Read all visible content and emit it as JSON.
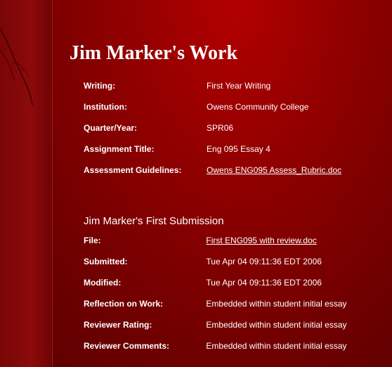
{
  "page": {
    "title": "Jim Marker's Work"
  },
  "work_info": [
    {
      "label": "Writing:",
      "value": "First Year Writing",
      "is_link": false
    },
    {
      "label": "Institution:",
      "value": "Owens Community College",
      "is_link": false
    },
    {
      "label": "Quarter/Year:",
      "value": "SPR06",
      "is_link": false
    },
    {
      "label": "Assignment Title:",
      "value": "Eng 095 Essay 4",
      "is_link": false
    },
    {
      "label": "Assessment Guidelines:",
      "value": "Owens ENG095 Assess_Rubric.doc",
      "is_link": true
    }
  ],
  "submission": {
    "heading": "Jim Marker's First Submission",
    "rows": [
      {
        "label": "File:",
        "value": "First ENG095 with review.doc",
        "is_link": true
      },
      {
        "label": "Submitted:",
        "value": "Tue Apr 04 09:11:36 EDT 2006",
        "is_link": false
      },
      {
        "label": "Modified:",
        "value": "Tue Apr 04 09:11:36 EDT 2006",
        "is_link": false
      },
      {
        "label": "Reflection on Work:",
        "value": "Embedded within student initial essay",
        "is_link": false
      },
      {
        "label": "Reviewer Rating:",
        "value": "Embedded within student initial essay",
        "is_link": false
      },
      {
        "label": "Reviewer Comments:",
        "value": "Embedded within student initial essay",
        "is_link": false
      }
    ]
  },
  "colors": {
    "background": "#8f0000",
    "text": "#ffffff"
  }
}
